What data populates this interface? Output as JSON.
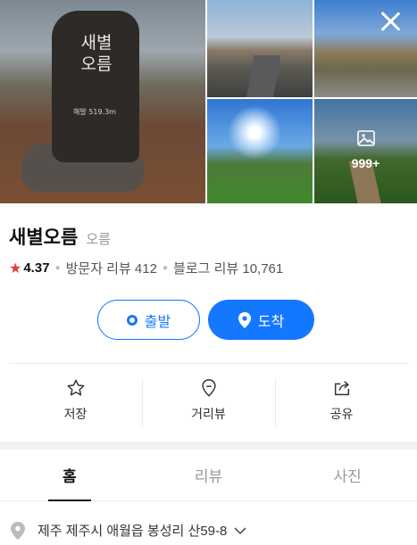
{
  "gallery": {
    "stone_text": "새별오름",
    "stone_subtext": "해발 519.3m",
    "more_count": "999+",
    "close_icon": "close-icon",
    "gallery_icon": "image-icon"
  },
  "place": {
    "name": "새별오름",
    "category": "오름",
    "rating": "4.37",
    "visitor_reviews": "방문자 리뷰 412",
    "blog_reviews": "블로그 리뷰 10,761"
  },
  "buttons": {
    "depart": "출발",
    "arrive": "도착"
  },
  "actions": [
    {
      "label": "저장",
      "icon": "star-outline-icon"
    },
    {
      "label": "거리뷰",
      "icon": "map-pin-icon"
    },
    {
      "label": "공유",
      "icon": "share-icon"
    }
  ],
  "tabs": [
    {
      "label": "홈",
      "active": true
    },
    {
      "label": "리뷰",
      "active": false
    },
    {
      "label": "사진",
      "active": false
    }
  ],
  "address": {
    "text": "제주 제주시 애월읍 봉성리 산59-8"
  },
  "colors": {
    "accent": "#1478ff",
    "star": "#e53e3e",
    "muted": "#999999"
  }
}
